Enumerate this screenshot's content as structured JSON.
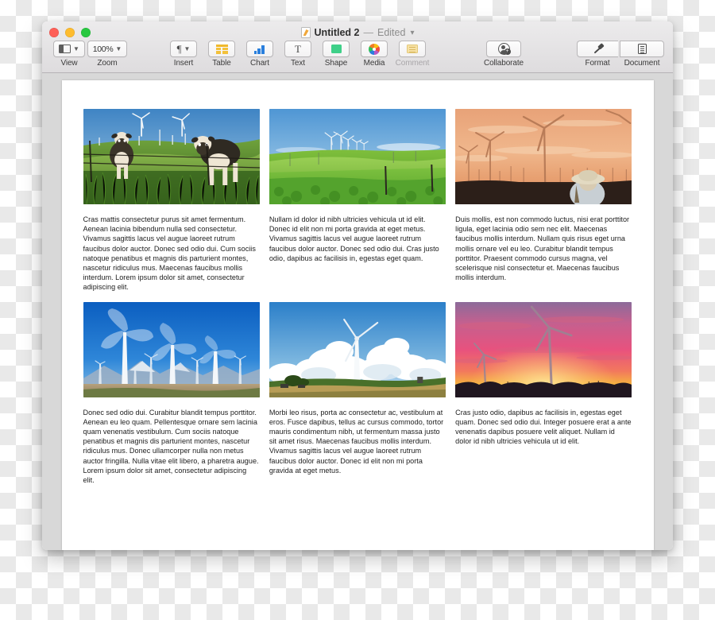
{
  "window": {
    "titlebar": {
      "document_icon": "pages-document-icon",
      "title": "Untitled 2",
      "separator": "—",
      "edited_status": "Edited",
      "chevron": "chevron-down-icon"
    },
    "traffic_lights": [
      {
        "name": "close",
        "color": "#fe5f57"
      },
      {
        "name": "minimize",
        "color": "#febc2e"
      },
      {
        "name": "zoom",
        "color": "#28c840"
      }
    ]
  },
  "toolbar": {
    "items": [
      {
        "id": "view",
        "label": "View",
        "icon": "sidebar-view-icon",
        "has_chevron": true,
        "value": ""
      },
      {
        "id": "zoom",
        "label": "Zoom",
        "icon": "zoom-level-icon",
        "has_chevron": true,
        "value": "100%"
      },
      {
        "id": "insert",
        "label": "Insert",
        "icon": "pilcrow-icon",
        "has_chevron": true,
        "value": "¶"
      },
      {
        "id": "table",
        "label": "Table",
        "icon": "table-icon",
        "has_chevron": false,
        "value": ""
      },
      {
        "id": "chart",
        "label": "Chart",
        "icon": "bar-chart-icon",
        "has_chevron": false,
        "value": ""
      },
      {
        "id": "text",
        "label": "Text",
        "icon": "text-box-icon",
        "has_chevron": false,
        "value": "T"
      },
      {
        "id": "shape",
        "label": "Shape",
        "icon": "shape-square-icon",
        "has_chevron": false,
        "value": ""
      },
      {
        "id": "media",
        "label": "Media",
        "icon": "photos-icon",
        "has_chevron": false,
        "value": ""
      },
      {
        "id": "comment",
        "label": "Comment",
        "icon": "comment-note-icon",
        "has_chevron": false,
        "value": "",
        "disabled": true
      },
      {
        "id": "collaborate",
        "label": "Collaborate",
        "icon": "collaborate-icon",
        "has_chevron": false,
        "value": ""
      },
      {
        "id": "format",
        "label": "Format",
        "icon": "format-brush-icon",
        "has_chevron": false,
        "value": ""
      },
      {
        "id": "document",
        "label": "Document",
        "icon": "document-lines-icon",
        "has_chevron": false,
        "value": ""
      }
    ]
  },
  "document": {
    "cells": [
      {
        "photo_alt": "two-cows-in-grass-field-with-wind-turbines",
        "caption": "Cras mattis consectetur purus sit amet fermentum. Aenean lacinia bibendum nulla sed consectetur. Vivamus sagittis lacus vel augue laoreet rutrum faucibus dolor auctor. Donec sed odio dui. Cum sociis natoque penatibus et magnis dis parturient montes, nascetur ridiculus mus. Maecenas faucibus mollis interdum. Lorem ipsum dolor sit amet, consectetur adipiscing elit."
      },
      {
        "photo_alt": "green-rolling-farm-field-with-distant-wind-turbines",
        "caption": "Nullam id dolor id nibh ultricies vehicula ut id elit. Donec id elit non mi porta gravida at eget metus. Vivamus sagittis lacus vel augue laoreet rutrum faucibus dolor auctor. Donec sed odio dui. Cras justo odio, dapibus ac facilisis in, egestas eget quam."
      },
      {
        "photo_alt": "man-in-straw-hat-watching-wind-farm-at-sunset",
        "caption": "Duis mollis, est non commodo luctus, nisi erat porttitor ligula, eget lacinia odio sem nec elit. Maecenas faucibus mollis interdum. Nullam quis risus eget urna mollis ornare vel eu leo. Curabitur blandit tempus porttitor. Praesent commodo cursus magna, vel scelerisque nisl consectetur et. Maecenas faucibus mollis interdum."
      },
      {
        "photo_alt": "white-wind-turbines-against-deep-blue-sky-with-mountains",
        "caption": "Donec sed odio dui. Curabitur blandit tempus porttitor. Aenean eu leo quam. Pellentesque ornare sem lacinia quam venenatis vestibulum. Cum sociis natoque penatibus et magnis dis parturient montes, nascetur ridiculus mus. Donec ullamcorper nulla non metus auctor fringilla. Nulla vitae elit libero, a pharetra augue. Lorem ipsum dolor sit amet, consectetur adipiscing elit."
      },
      {
        "photo_alt": "single-wind-turbine-with-cumulus-clouds-over-farmland",
        "caption": "Morbi leo risus, porta ac consectetur ac, vestibulum at eros. Fusce dapibus, tellus ac cursus commodo, tortor mauris condimentum nibh, ut fermentum massa justo sit amet risus. Maecenas faucibus mollis interdum. Vivamus sagittis lacus vel augue laoreet rutrum faucibus dolor auctor. Donec id elit non mi porta gravida at eget metus."
      },
      {
        "photo_alt": "wind-turbine-silhouettes-against-pink-and-orange-sunset",
        "caption": "Cras justo odio, dapibus ac facilisis in, egestas eget quam. Donec sed odio dui. Integer posuere erat a ante venenatis dapibus posuere velit aliquet. Nullam id dolor id nibh ultricies vehicula ut id elit."
      }
    ]
  },
  "colors": {
    "traffic_red": "#fe5f57",
    "traffic_yellow": "#febc2e",
    "traffic_green": "#28c840",
    "chart_blue": "#2a7fdd",
    "table_yellow": "#f3c13a",
    "shape_green": "#3fd089",
    "canvas_gray": "#d8d8d8",
    "page_white": "#ffffff"
  }
}
